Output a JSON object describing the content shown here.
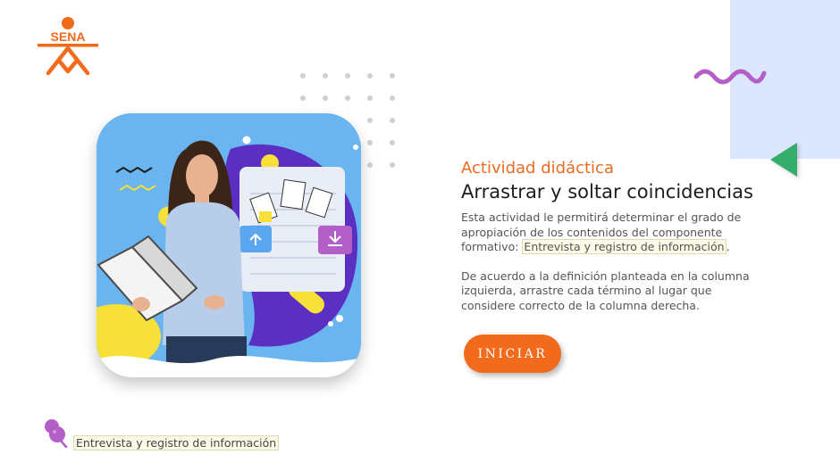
{
  "brand": {
    "logo_text": "SENA",
    "logo_color": "#f26a1b"
  },
  "activity": {
    "subtitle": "Actividad didáctica",
    "title": "Arrastrar y soltar coincidencias",
    "intro": "Esta actividad le permitirá determinar el grado de apropiación de los contenidos del componente formativo:",
    "topic": "Entrevista y registro de información",
    "topic_suffix": ".",
    "instructions": "De acuerdo a la definición planteada en la columna izquierda, arrastre cada término al lugar que considere correcto de la columna derecha."
  },
  "start_button": {
    "label": "INICIAR"
  },
  "footer": {
    "topic_label": "Entrevista y registro de información",
    "pin_icon": "pushpin-icon"
  },
  "colors": {
    "accent_orange": "#f26a1b",
    "title_orange": "#ea6b22",
    "purple": "#b45fc8",
    "green": "#34ad6a",
    "panel_blue": "#dce6fd",
    "hero_blue": "#6ab4ef"
  }
}
